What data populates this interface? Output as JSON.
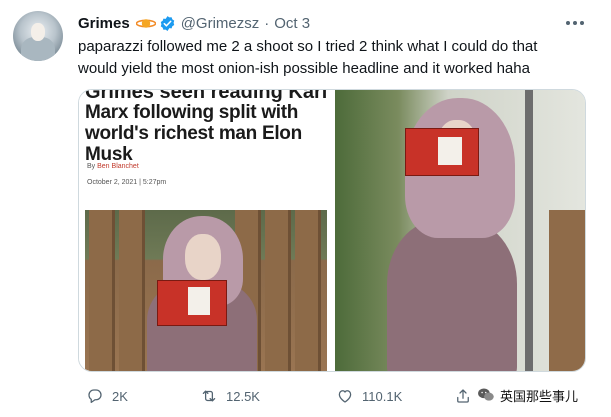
{
  "tweet": {
    "name": "Grimes",
    "handle": "@Grimezsz",
    "separator": "·",
    "date": "Oct 3",
    "text": "paparazzi followed me 2 a shoot so I tried 2 think what I could do that would yield the most onion-ish possible headline and it worked haha"
  },
  "media": {
    "clipped_top_line": "Grimes seen reading Karl",
    "headline": "Marx following split with world's richest man Elon Musk",
    "byline_prefix": "By",
    "byline_author": "Ben Blanchet",
    "published": "October 2, 2021 | 5:27pm"
  },
  "actions": {
    "replies": "2K",
    "retweets": "12.5K",
    "likes": "110.1K"
  },
  "watermark": {
    "text": "英国那些事儿"
  },
  "colors": {
    "text_primary": "#0f1419",
    "text_secondary": "#536471",
    "verified_blue": "#1d9bf0",
    "border": "#cfd9de",
    "byline_red": "#c0392b"
  },
  "icons": {
    "sticker": "orange-planet-icon",
    "verified": "verified-badge-icon",
    "more": "more-options-icon",
    "reply": "reply-icon",
    "retweet": "retweet-icon",
    "like": "heart-icon",
    "share": "share-icon",
    "watermark": "wechat-icon"
  }
}
